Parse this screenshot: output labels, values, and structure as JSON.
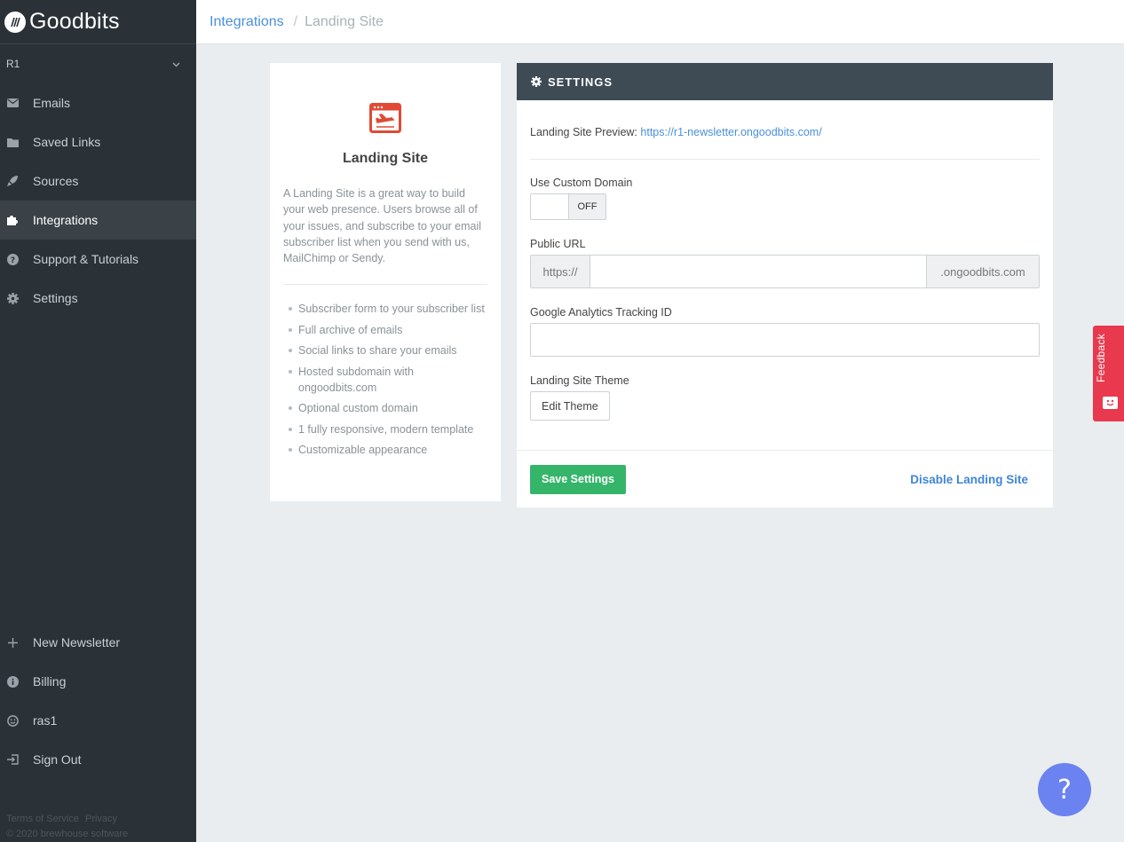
{
  "app": {
    "name": "Goodbits"
  },
  "sidebar": {
    "account": "R1",
    "items": [
      {
        "label": "Emails",
        "icon": "envelope-icon"
      },
      {
        "label": "Saved Links",
        "icon": "folder-icon"
      },
      {
        "label": "Sources",
        "icon": "rocket-icon"
      },
      {
        "label": "Integrations",
        "icon": "puzzle-icon",
        "active": true
      },
      {
        "label": "Support & Tutorials",
        "icon": "question-icon"
      },
      {
        "label": "Settings",
        "icon": "gear-icon"
      }
    ],
    "bottom_items": [
      {
        "label": "New Newsletter",
        "icon": "plus-icon"
      },
      {
        "label": "Billing",
        "icon": "info-icon"
      },
      {
        "label": "ras1",
        "icon": "smiley-icon"
      },
      {
        "label": "Sign Out",
        "icon": "sign-out-icon"
      }
    ],
    "footer": {
      "terms": "Terms of Service",
      "privacy": "Privacy",
      "copyright": "© 2020 brewhouse software"
    }
  },
  "breadcrumb": {
    "parent": "Integrations",
    "separator": "/",
    "current": "Landing Site"
  },
  "info_card": {
    "title": "Landing Site",
    "description": "A Landing Site is a great way to build your web presence. Users browse all of your issues, and subscribe to your email subscriber list when you send with us, MailChimp or Sendy.",
    "features": [
      "Subscriber form to your subscriber list",
      "Full archive of emails",
      "Social links to share your emails",
      "Hosted subdomain with ongoodbits.com",
      "Optional custom domain",
      "1 fully responsive, modern template",
      "Customizable appearance"
    ]
  },
  "settings": {
    "header": "SETTINGS",
    "preview_label": "Landing Site Preview:",
    "preview_url": "https://r1-newsletter.ongoodbits.com/",
    "custom_domain_label": "Use Custom Domain",
    "custom_domain_state": "OFF",
    "public_url_label": "Public URL",
    "public_url_prefix": "https://",
    "public_url_value": "",
    "public_url_suffix": ".ongoodbits.com",
    "ga_label": "Google Analytics Tracking ID",
    "ga_value": "",
    "theme_label": "Landing Site Theme",
    "edit_theme_button": "Edit Theme",
    "save_button": "Save Settings",
    "disable_link": "Disable Landing Site"
  },
  "feedback": {
    "label": "Feedback"
  },
  "help": {
    "label": "?"
  },
  "colors": {
    "sidebar_bg": "#2b3237",
    "accent_blue": "#4a90d9",
    "save_green": "#35b56a",
    "settings_header": "#3e4b55",
    "feedback_red": "#e8394e",
    "help_bubble": "#6b83f0",
    "icon_red": "#e04a35"
  }
}
